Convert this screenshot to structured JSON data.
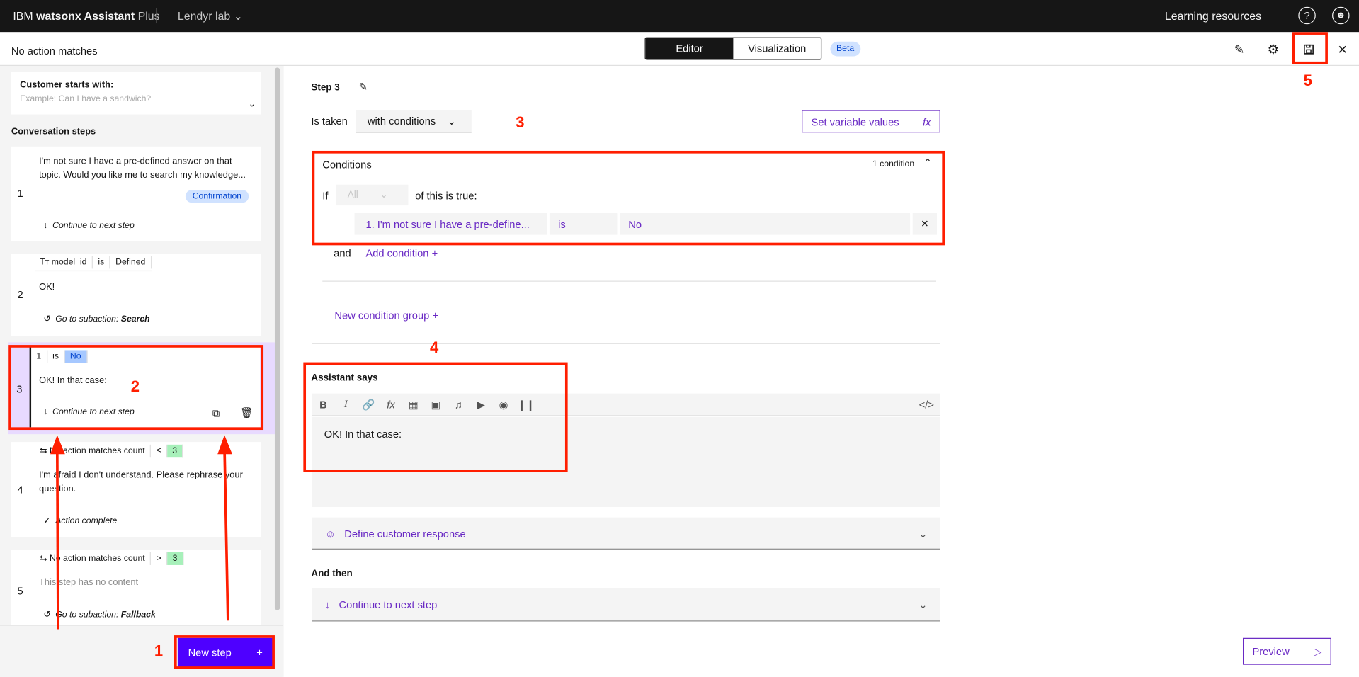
{
  "topbar": {
    "brand_prefix": "IBM",
    "brand_name": "watsonx Assistant",
    "plan": "Plus",
    "workspace": "Lendyr lab",
    "learning": "Learning resources"
  },
  "header": {
    "title": "No action matches",
    "tab_editor": "Editor",
    "tab_visualization": "Visualization",
    "beta": "Beta"
  },
  "sidebar": {
    "customer_label": "Customer starts with:",
    "customer_placeholder": "Example: Can I have a sandwich?",
    "conversation_steps": "Conversation steps",
    "steps": [
      {
        "num": "1",
        "text": "I'm not sure I have a pre-defined answer on that topic. Would you like me to search my knowledge...",
        "badge": "Confirmation",
        "footer": "Continue to next step"
      },
      {
        "num": "2",
        "cond_var": "model_id",
        "cond_op": "is",
        "cond_val": "Defined",
        "text": "OK!",
        "footer": "Go to subaction:",
        "footer_target": "Search"
      },
      {
        "num": "3",
        "cond_var": "1",
        "cond_op": "is",
        "cond_val": "No",
        "text": "OK! In that case:",
        "footer": "Continue to next step"
      },
      {
        "num": "4",
        "cond_var": "No action matches count",
        "cond_op": "≤",
        "cond_val": "3",
        "text": "I'm afraid I don't understand. Please rephrase your question.",
        "footer": "Action complete"
      },
      {
        "num": "5",
        "cond_var": "No action matches count",
        "cond_op": ">",
        "cond_val": "3",
        "text": "This step has no content",
        "footer": "Go to subaction:",
        "footer_target": "Fallback"
      }
    ],
    "new_step": "New step"
  },
  "editor": {
    "step_title": "Step 3",
    "is_taken": "Is taken",
    "taken_value": "with conditions",
    "set_variable": "Set variable values",
    "conditions_title": "Conditions",
    "conditions_count": "1 condition",
    "if": "If",
    "all": "All",
    "of_this": "of this is true:",
    "cond_left": "1. I'm not sure I have a pre-define...",
    "cond_op": "is",
    "cond_right": "No",
    "and": "and",
    "add_condition": "Add condition",
    "new_group": "New condition group",
    "assistant_says": "Assistant says",
    "message": "OK! In that case:",
    "define_response": "Define customer response",
    "and_then": "And then",
    "continue_next": "Continue to next step",
    "preview": "Preview"
  },
  "annotations": [
    "1",
    "2",
    "3",
    "4",
    "5"
  ],
  "colors": {
    "accent": "#6929c4",
    "new_step_bg": "#4e00ff",
    "annotation": "#ff1e00"
  }
}
